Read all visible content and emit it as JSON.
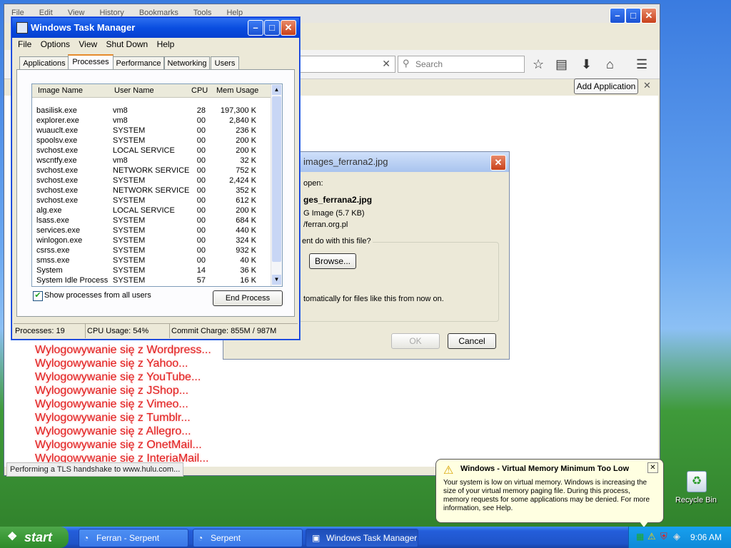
{
  "browser": {
    "menu": [
      "File",
      "Edit",
      "View",
      "History",
      "Bookmarks",
      "Tools",
      "Help"
    ],
    "search_placeholder": "Search",
    "add_application_label": "Add Application",
    "status_text": "Performing a TLS handshake to www.hulu.com...",
    "content_lines": [
      "Wylogowywanie się z Wordpress...",
      "Wylogowywanie się z Yahoo...",
      "Wylogowywanie się z YouTube...",
      "Wylogowywanie się z JShop...",
      "Wylogowywanie się z Vimeo...",
      "Wylogowywanie się z Tumblr...",
      "Wylogowywanie się z Allegro...",
      "Wylogowywanie się z OnetMail...",
      "Wylogowywanie się z InteriaMail..."
    ]
  },
  "download_dialog": {
    "title": "images_ferrana2.jpg",
    "opening_label": "open:",
    "file_name": "ges_ferrana2.jpg",
    "file_type": "G Image (5.7 KB)",
    "from_url": "/ferran.org.pl",
    "question": "ent do with this file?",
    "browse_label": "Browse...",
    "auto_label": "tomatically for files like this from now on.",
    "ok_label": "OK",
    "cancel_label": "Cancel"
  },
  "task_manager": {
    "title": "Windows Task Manager",
    "menu": [
      "File",
      "Options",
      "View",
      "Shut Down",
      "Help"
    ],
    "tabs": [
      "Applications",
      "Processes",
      "Performance",
      "Networking",
      "Users"
    ],
    "columns": [
      "Image Name",
      "User Name",
      "CPU",
      "Mem Usage"
    ],
    "processes": [
      {
        "name": "basilisk.exe",
        "user": "vm8",
        "cpu": "28",
        "mem": "197,300 K"
      },
      {
        "name": "explorer.exe",
        "user": "vm8",
        "cpu": "00",
        "mem": "2,840 K"
      },
      {
        "name": "wuauclt.exe",
        "user": "SYSTEM",
        "cpu": "00",
        "mem": "236 K"
      },
      {
        "name": "spoolsv.exe",
        "user": "SYSTEM",
        "cpu": "00",
        "mem": "200 K"
      },
      {
        "name": "svchost.exe",
        "user": "LOCAL SERVICE",
        "cpu": "00",
        "mem": "200 K"
      },
      {
        "name": "wscntfy.exe",
        "user": "vm8",
        "cpu": "00",
        "mem": "32 K"
      },
      {
        "name": "svchost.exe",
        "user": "NETWORK SERVICE",
        "cpu": "00",
        "mem": "752 K"
      },
      {
        "name": "svchost.exe",
        "user": "SYSTEM",
        "cpu": "00",
        "mem": "2,424 K"
      },
      {
        "name": "svchost.exe",
        "user": "NETWORK SERVICE",
        "cpu": "00",
        "mem": "352 K"
      },
      {
        "name": "svchost.exe",
        "user": "SYSTEM",
        "cpu": "00",
        "mem": "612 K"
      },
      {
        "name": "alg.exe",
        "user": "LOCAL SERVICE",
        "cpu": "00",
        "mem": "200 K"
      },
      {
        "name": "lsass.exe",
        "user": "SYSTEM",
        "cpu": "00",
        "mem": "684 K"
      },
      {
        "name": "services.exe",
        "user": "SYSTEM",
        "cpu": "00",
        "mem": "440 K"
      },
      {
        "name": "winlogon.exe",
        "user": "SYSTEM",
        "cpu": "00",
        "mem": "324 K"
      },
      {
        "name": "csrss.exe",
        "user": "SYSTEM",
        "cpu": "00",
        "mem": "932 K"
      },
      {
        "name": "smss.exe",
        "user": "SYSTEM",
        "cpu": "00",
        "mem": "40 K"
      },
      {
        "name": "System",
        "user": "SYSTEM",
        "cpu": "14",
        "mem": "36 K"
      },
      {
        "name": "System Idle Process",
        "user": "SYSTEM",
        "cpu": "57",
        "mem": "16 K"
      }
    ],
    "show_all_label": "Show processes from all users",
    "end_process_label": "End Process",
    "status": {
      "processes": "Processes: 19",
      "cpu": "CPU Usage: 54%",
      "commit": "Commit Charge: 855M / 987M"
    }
  },
  "balloon": {
    "title": "Windows - Virtual Memory Minimum Too Low",
    "body": "Your system is low on virtual memory. Windows is increasing the size of your virtual memory paging file. During this process, memory requests for some applications may be denied. For more information, see Help."
  },
  "desktop": {
    "recycle_bin_label": "Recycle Bin"
  },
  "taskbar": {
    "start_label": "start",
    "tasks": [
      "Ferran - Serpent",
      "Serpent",
      "Windows Task Manager"
    ],
    "clock": "9:06 AM"
  }
}
